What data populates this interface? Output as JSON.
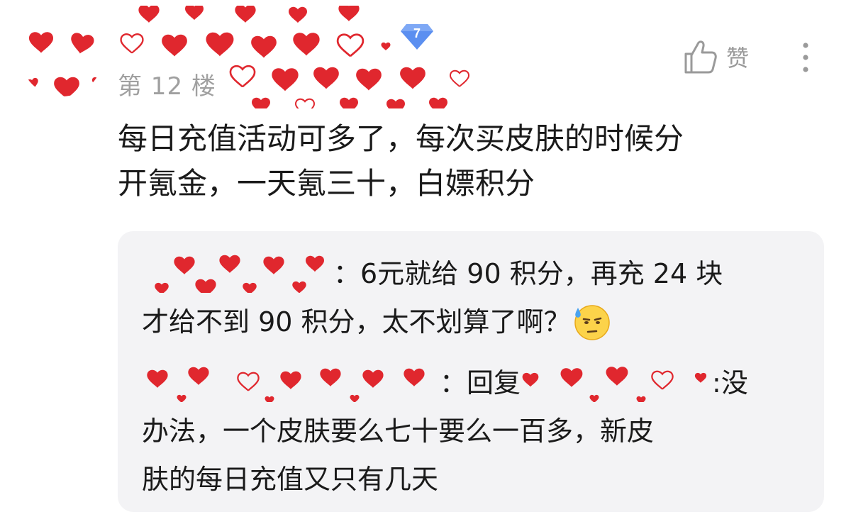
{
  "floor": {
    "label": "第 12 楼",
    "level": "7"
  },
  "actions": {
    "like_label": "赞"
  },
  "post": {
    "line1": "每日充值活动可多了，每次买皮肤的时候分",
    "line2": "开氪金，一天氪三十，白嫖积分"
  },
  "replies": [
    {
      "sep": "：",
      "line1": "6元就给 90 积分，再充 24 块",
      "line2": "才给不到 90 积分，太不划算了啊？",
      "emoji": "sweat-doubtful-emoji"
    },
    {
      "sep": "：",
      "reply_word": "回复",
      "sep2": ":没",
      "line2": "办法，一个皮肤要么七十要么一百多，新皮",
      "line3": "肤的每日充值又只有几天"
    }
  ],
  "colors": {
    "heart_red": "#e0272e",
    "floor_gray": "#a0a0a0",
    "reply_bg": "#f3f3f5",
    "badge_blue": "#5b8ff0"
  }
}
